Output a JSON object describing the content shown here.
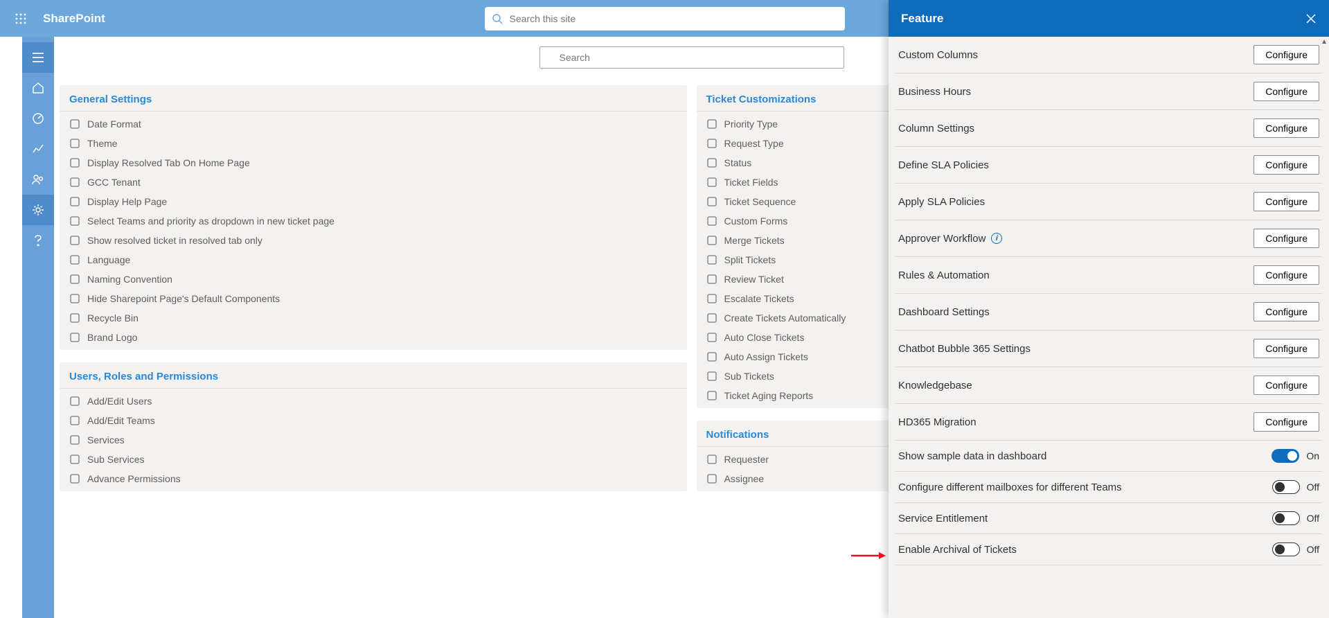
{
  "topbar": {
    "brand": "SharePoint",
    "search_placeholder": "Search this site"
  },
  "page_search_placeholder": "Search",
  "leftnav_icons": [
    "home",
    "dashboard",
    "chart",
    "people",
    "gear",
    "help"
  ],
  "general_settings": {
    "title": "General Settings",
    "items": [
      "Date Format",
      "Theme",
      "Display Resolved Tab On Home Page",
      "GCC Tenant",
      "Display Help Page",
      "Select Teams and priority as dropdown in new ticket page",
      "Show resolved ticket in resolved tab only",
      "Language",
      "Naming Convention",
      "Hide Sharepoint Page's Default Components",
      "Recycle Bin",
      "Brand Logo"
    ]
  },
  "users_roles": {
    "title": "Users, Roles and Permissions",
    "items": [
      "Add/Edit Users",
      "Add/Edit Teams",
      "Services",
      "Sub Services",
      "Advance Permissions"
    ]
  },
  "ticket_custom": {
    "title": "Ticket Customizations",
    "items": [
      "Priority Type",
      "Request Type",
      "Status",
      "Ticket Fields",
      "Ticket Sequence",
      "Custom Forms",
      "Merge Tickets",
      "Split Tickets",
      "Review Ticket",
      "Escalate Tickets",
      "Create Tickets Automatically",
      "Auto Close Tickets",
      "Auto Assign Tickets",
      "Sub Tickets",
      "Ticket Aging Reports"
    ]
  },
  "notifications": {
    "title": "Notifications",
    "items": [
      "Requester",
      "Assignee"
    ]
  },
  "panel": {
    "title": "Feature",
    "configure_label": "Configure",
    "on_label": "On",
    "off_label": "Off",
    "items": [
      {
        "label": "Custom Columns",
        "type": "button"
      },
      {
        "label": "Business Hours",
        "type": "button"
      },
      {
        "label": "Column Settings",
        "type": "button"
      },
      {
        "label": "Define SLA Policies",
        "type": "button"
      },
      {
        "label": "Apply SLA Policies",
        "type": "button"
      },
      {
        "label": "Approver Workflow",
        "type": "button",
        "info": true
      },
      {
        "label": "Rules & Automation",
        "type": "button"
      },
      {
        "label": "Dashboard Settings",
        "type": "button"
      },
      {
        "label": "Chatbot Bubble 365 Settings",
        "type": "button"
      },
      {
        "label": "Knowledgebase",
        "type": "button"
      },
      {
        "label": "HD365 Migration",
        "type": "button"
      },
      {
        "label": "Show sample data in dashboard",
        "type": "toggle",
        "value": true
      },
      {
        "label": "Configure different mailboxes for different Teams",
        "type": "toggle",
        "value": false
      },
      {
        "label": "Service Entitlement",
        "type": "toggle",
        "value": false,
        "arrow": true
      },
      {
        "label": "Enable Archival of Tickets",
        "type": "toggle",
        "value": false
      }
    ]
  }
}
